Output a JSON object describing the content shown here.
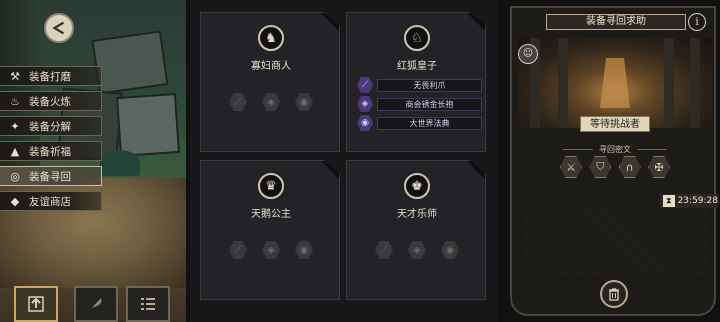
{
  "sidebar": {
    "items": [
      {
        "label": "装备打磨",
        "icon": "hammer-icon"
      },
      {
        "label": "装备火炼",
        "icon": "flame-icon"
      },
      {
        "label": "装备分解",
        "icon": "break-icon"
      },
      {
        "label": "装备祈福",
        "icon": "pray-icon"
      },
      {
        "label": "装备寻回",
        "icon": "retrieve-icon",
        "active": true
      },
      {
        "label": "友谊商店",
        "icon": "fox-icon"
      }
    ]
  },
  "cards": [
    {
      "name": "寡妇商人",
      "portrait": "♞"
    },
    {
      "name": "红狐皇子",
      "portrait": "♘",
      "items": [
        "无畏利爪",
        "商会锈金长袍",
        "大世界法典"
      ]
    },
    {
      "name": "天鹅公主",
      "portrait": "♛"
    },
    {
      "name": "天才乐师",
      "portrait": "♚"
    }
  ],
  "panel": {
    "title": "装备寻回求助",
    "info": "i",
    "waiting": "等待挑战者",
    "subtitle": "寻回密文",
    "timer": "23:59:28"
  },
  "colors": {
    "accent": "#c4a968",
    "item_purple": "#4a3a7a"
  }
}
